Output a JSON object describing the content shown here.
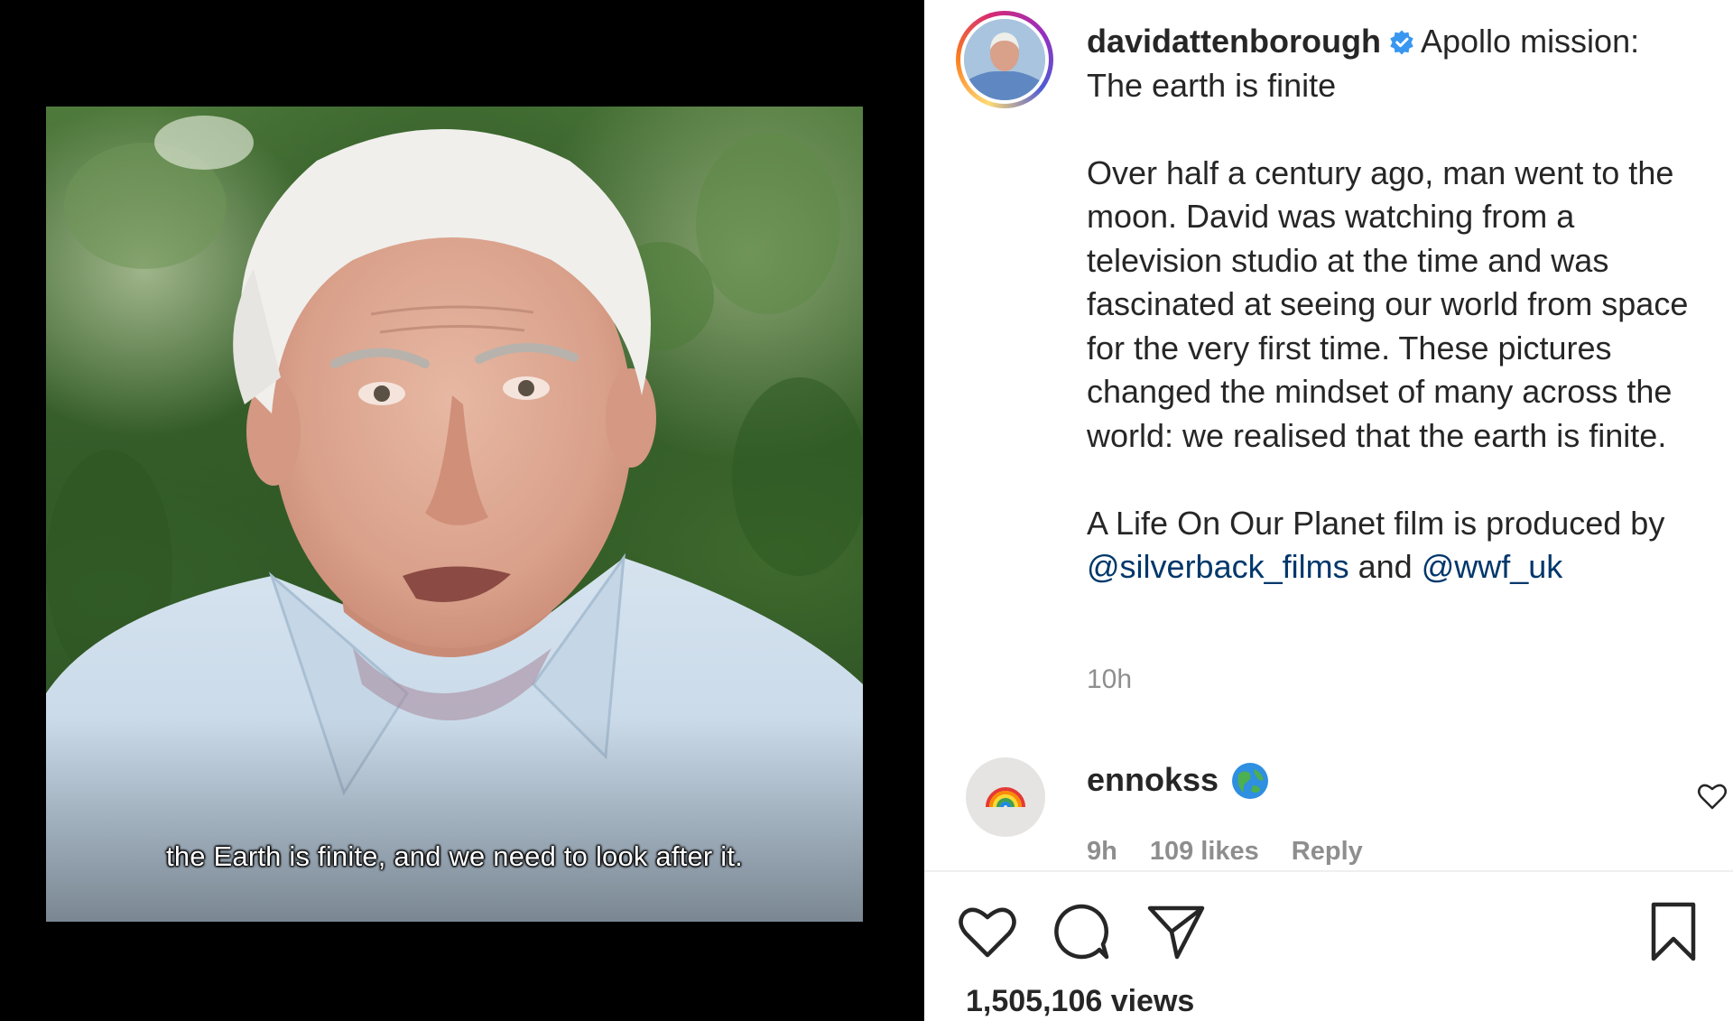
{
  "media": {
    "subtitle": "the Earth is finite, and we need to look after it."
  },
  "post": {
    "username": "davidattenborough",
    "verified": true,
    "caption_title_line1": "Apollo mission:",
    "caption_title_line2": "The earth is finite",
    "paragraph1": "Over half a century ago, man went to the moon. David was watching from a television studio at the time and was fascinated at seeing our world from space for the very first time. These pictures changed the mindset of many across the world: we realised that the earth is finite.",
    "paragraph2_text": "A Life On Our Planet film is produced by",
    "mention1": "@silverback_films",
    "and_word": "and",
    "mention2": "@wwf_uk",
    "time_ago": "10h"
  },
  "comment": {
    "username": "ennokss",
    "emoji_icon": "globe-icon",
    "time": "9h",
    "likes": "109 likes",
    "reply_label": "Reply"
  },
  "actions": {
    "views": "1,505,106 views",
    "icons": [
      "heart-icon",
      "comment-icon",
      "share-icon",
      "bookmark-icon"
    ]
  },
  "colors": {
    "mention": "#00376b",
    "verified_blue": "#3897f0",
    "muted": "#8e8e8e",
    "text": "#262626"
  }
}
